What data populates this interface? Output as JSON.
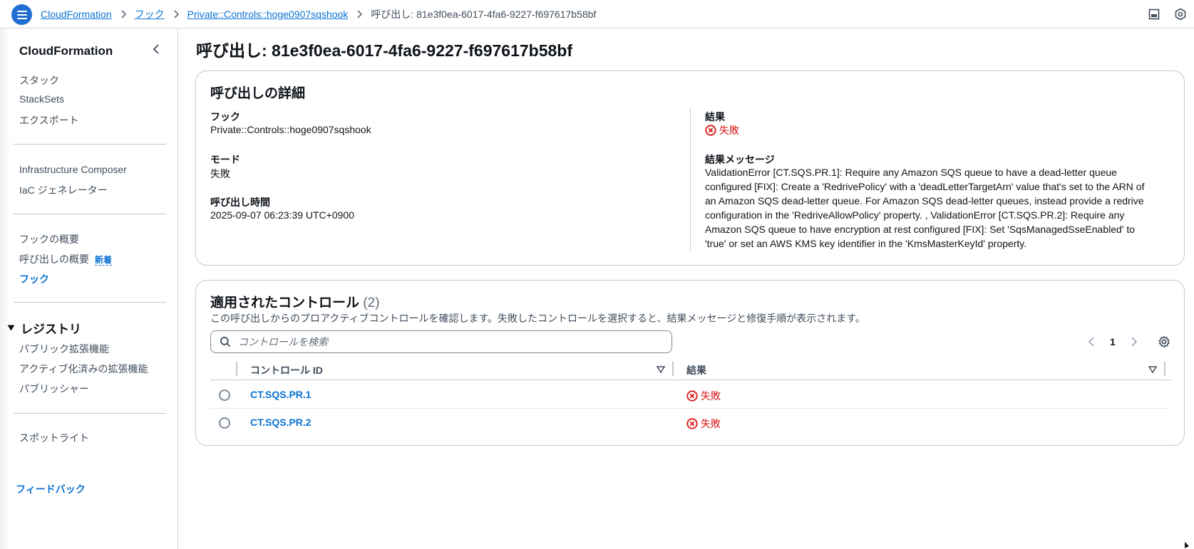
{
  "breadcrumbs": [
    {
      "label": "CloudFormation"
    },
    {
      "label": "フック"
    },
    {
      "label": "Private::Controls::hoge0907sqshook"
    }
  ],
  "breadcrumb_current": "呼び出し: 81e3f0ea-6017-4fa6-9227-f697617b58bf",
  "sidebar": {
    "title": "CloudFormation",
    "group1": [
      "スタック",
      "StackSets",
      "エクスポート"
    ],
    "group2": [
      "Infrastructure Composer",
      "IaC ジェネレーター"
    ],
    "group3": [
      "フックの概要",
      "呼び出しの概要",
      "フック"
    ],
    "new_badge": "新着",
    "registry": {
      "title": "レジストリ",
      "items": [
        "パブリック拡張機能",
        "アクティブ化済みの拡張機能",
        "パブリッシャー"
      ]
    },
    "spotlight": "スポットライト",
    "feedback": "フィードバック"
  },
  "page_title": "呼び出し: 81e3f0ea-6017-4fa6-9227-f697617b58bf",
  "details": {
    "title": "呼び出しの詳細",
    "hook_label": "フック",
    "hook_value": "Private::Controls::hoge0907sqshook",
    "mode_label": "モード",
    "mode_value": "失敗",
    "time_label": "呼び出し時間",
    "time_value": "2025-09-07 06:23:39 UTC+0900",
    "result_label": "結果",
    "result_value": "失敗",
    "message_label": "結果メッセージ",
    "message_lines": [
      "ValidationError [CT.SQS.PR.1]: Require any Amazon SQS queue to have a dead-letter queue",
      "configured [FIX]: Create a 'RedrivePolicy' with a 'deadLetterTargetArn' value that's set to the ARN of",
      "an Amazon SQS dead-letter queue. For Amazon SQS dead-letter queues, instead provide a redrive",
      "configuration in the 'RedriveAllowPolicy' property. , ValidationError [CT.SQS.PR.2]: Require any",
      "Amazon SQS queue to have encryption at rest configured [FIX]: Set 'SqsManagedSseEnabled' to",
      "'true' or set an AWS KMS key identifier in the 'KmsMasterKeyId' property."
    ]
  },
  "controls": {
    "title": "適用されたコントロール",
    "count": "(2)",
    "description": "この呼び出しからのプロアクティブコントロールを確認します。失敗したコントロールを選択すると、結果メッセージと修復手順が表示されます。",
    "search_placeholder": "コントロールを検索",
    "page": "1",
    "columns": [
      "コントロール ID",
      "結果"
    ],
    "rows": [
      {
        "id": "CT.SQS.PR.1",
        "result": "失敗"
      },
      {
        "id": "CT.SQS.PR.2",
        "result": "失敗"
      }
    ]
  },
  "colors": {
    "link": "#0972d3",
    "error": "#d91515",
    "menu_button": "#1f6fd1"
  },
  "icons": [
    "hamburger-menu-icon",
    "chevron-right-icon",
    "panel-icon",
    "settings-hex-icon",
    "chevron-left-icon",
    "caret-down-icon",
    "search-icon",
    "error-circle-icon",
    "gear-icon",
    "sort-caret-icon"
  ]
}
